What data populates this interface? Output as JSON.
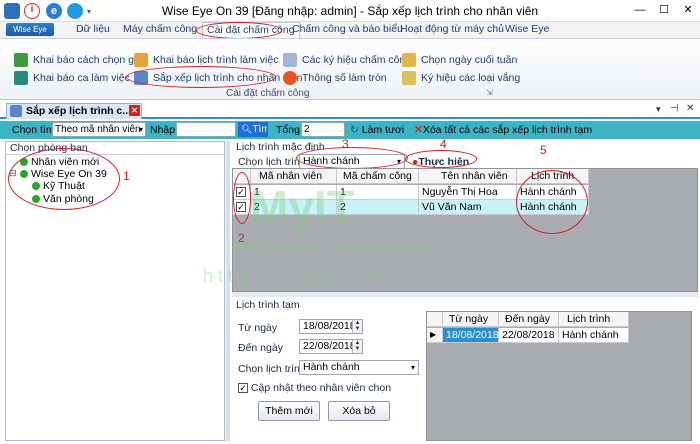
{
  "window": {
    "title": "Wise Eye On 39 [Đăng nhập: admin] - Sắp xếp lịch trình cho nhân viên",
    "controls": {
      "minimize": "—",
      "maximize": "☐",
      "close": "✕"
    }
  },
  "ribbon": {
    "app_button": "Wise Eye",
    "tabs": [
      "Dữ liệu",
      "Máy chấm công",
      "Cài đặt chấm công",
      "Chấm công và báo biểu",
      "Hoạt động từ máy chủ",
      "Wise Eye"
    ],
    "items": {
      "khai_bao_cach_chon_gio": "Khai báo cách chọn giờ",
      "khai_bao_ca_lam_viec": "Khai báo ca làm việc",
      "khai_bao_lich_trinh_lam_viec": "Khai báo lịch trình làm việc",
      "sap_xep_lich_trinh": "Sắp xếp lịch trình cho nhân viên",
      "cac_ky_hieu_cham_cong": "Các ký hiệu chấm công",
      "thong_so_lam_tron": "Thông số làm tròn",
      "chon_ngay_cuoi_tuan": "Chọn ngày cuối tuần",
      "ky_hieu_cac_loai_vang": "Ký hiệu các loại vắng"
    },
    "group_label": "Cài đặt chấm công"
  },
  "document_tab": {
    "label": "Sắp xếp lịch trình c..."
  },
  "toolbar": {
    "chon_tim_label": "Chọn tìm",
    "chon_tim_value": "Theo mã nhân viên",
    "nhap_label": "Nhập",
    "nhap_value": "",
    "tim_button": "Tìm",
    "tong_label": "Tổng",
    "tong_value": "2",
    "lam_tuoi": "Làm tươi",
    "xoa_tat_ca": "Xóa tất cả các sắp xếp lịch trình tạm"
  },
  "left_panel": {
    "title": "Chọn phòng ban",
    "tree": [
      {
        "label": "Nhân viên mới",
        "level": 0
      },
      {
        "label": "Wise Eye On 39",
        "level": 0
      },
      {
        "label": "Kỹ Thuật",
        "level": 1
      },
      {
        "label": "Văn phòng",
        "level": 1
      }
    ]
  },
  "default_schedule": {
    "title": "Lịch trình mặc định",
    "chon_lich_trinh_label": "Chọn lịch trình",
    "chon_lich_trinh_value": "Hành chánh",
    "thuc_hien_button": "Thực hiện",
    "columns": [
      "Mã nhân viên",
      "Mã chấm công",
      "Tên nhân viên",
      "Lịch trình"
    ],
    "rows": [
      {
        "checked": true,
        "ma_nv": "1",
        "ma_cc": "1",
        "ten": "Nguyễn Thị Hoa",
        "lich_trinh": "Hành chánh"
      },
      {
        "checked": true,
        "ma_nv": "2",
        "ma_cc": "2",
        "ten": "Vũ Văn Nam",
        "lich_trinh": "Hành chánh"
      }
    ]
  },
  "temp_schedule": {
    "title": "Lịch trình tạm",
    "tu_ngay_label": "Từ ngày",
    "tu_ngay_value": "18/08/2018",
    "den_ngay_label": "Đến ngày",
    "den_ngay_value": "22/08/2018",
    "chon_lich_trinh_label": "Chọn lịch trình",
    "chon_lich_trinh_value": "Hành chánh",
    "cap_nhat_label": "Cập nhật theo nhân viên chọn",
    "cap_nhat_checked": true,
    "them_moi_button": "Thêm mới",
    "xoa_bo_button": "Xóa bỏ",
    "grid_columns": [
      "Từ ngày",
      "Đến ngày",
      "Lịch trình"
    ],
    "grid_rows": [
      {
        "tu_ngay": "18/08/2018",
        "den_ngay": "22/08/2018",
        "lich_trinh": "Hành chánh"
      }
    ]
  },
  "annotations": [
    "1",
    "2",
    "3",
    "4",
    "5"
  ],
  "watermark": {
    "text": "MyIT",
    "slogan": "Our solutions your success!",
    "url": "https://myit.vn"
  },
  "colors": {
    "toolbar": "#3bb5c4",
    "selection": "#c8f2f6",
    "annotation": "#d62020",
    "tab_accent": "#2a8fd0"
  }
}
